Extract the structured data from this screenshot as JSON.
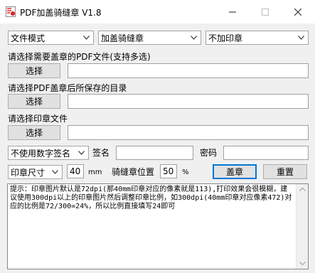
{
  "window": {
    "title": "PDF加盖骑缝章 V1.8",
    "icon": "pdf-app-icon",
    "controls": [
      "minimize-icon",
      "maximize-icon",
      "close-icon"
    ]
  },
  "selectors": {
    "mode": {
      "value": "文件模式"
    },
    "stamp_type": {
      "value": "加盖骑缝章"
    },
    "seal_option": {
      "value": "不加印章"
    }
  },
  "pdf_input": {
    "label": "请选择需要盖章的PDF文件(支持多选)",
    "button": "选择",
    "value": ""
  },
  "save_dir": {
    "label": "请选择PDF盖章后所保存的目录",
    "button": "选择",
    "value": ""
  },
  "seal_file": {
    "label": "请选择印章文件",
    "button": "选择",
    "value": ""
  },
  "signature": {
    "select_value": "不使用数字签名",
    "sign_label": "签名",
    "sign_value": "",
    "password_label": "密码",
    "password_value": ""
  },
  "seal_settings": {
    "size_select": "印章尺寸",
    "size_value": "40",
    "size_unit": "mm",
    "position_label": "骑缝章位置",
    "position_value": "50",
    "position_unit": "%",
    "stamp_button": "盖章",
    "reset_button": "重置"
  },
  "hint": "提示：印章图片默认是72dpi(那40mm印章对应的像素就是113),打印效果会很模糊，建议使用300dpi以上的印章图片然后调整印章比例，如300dpi(40mm印章对应像素472)对应的比例是72/300=24%，所以比例直接填写24即可",
  "colors": {
    "accent": "#0078d7",
    "pdf_icon": "#e02020"
  }
}
